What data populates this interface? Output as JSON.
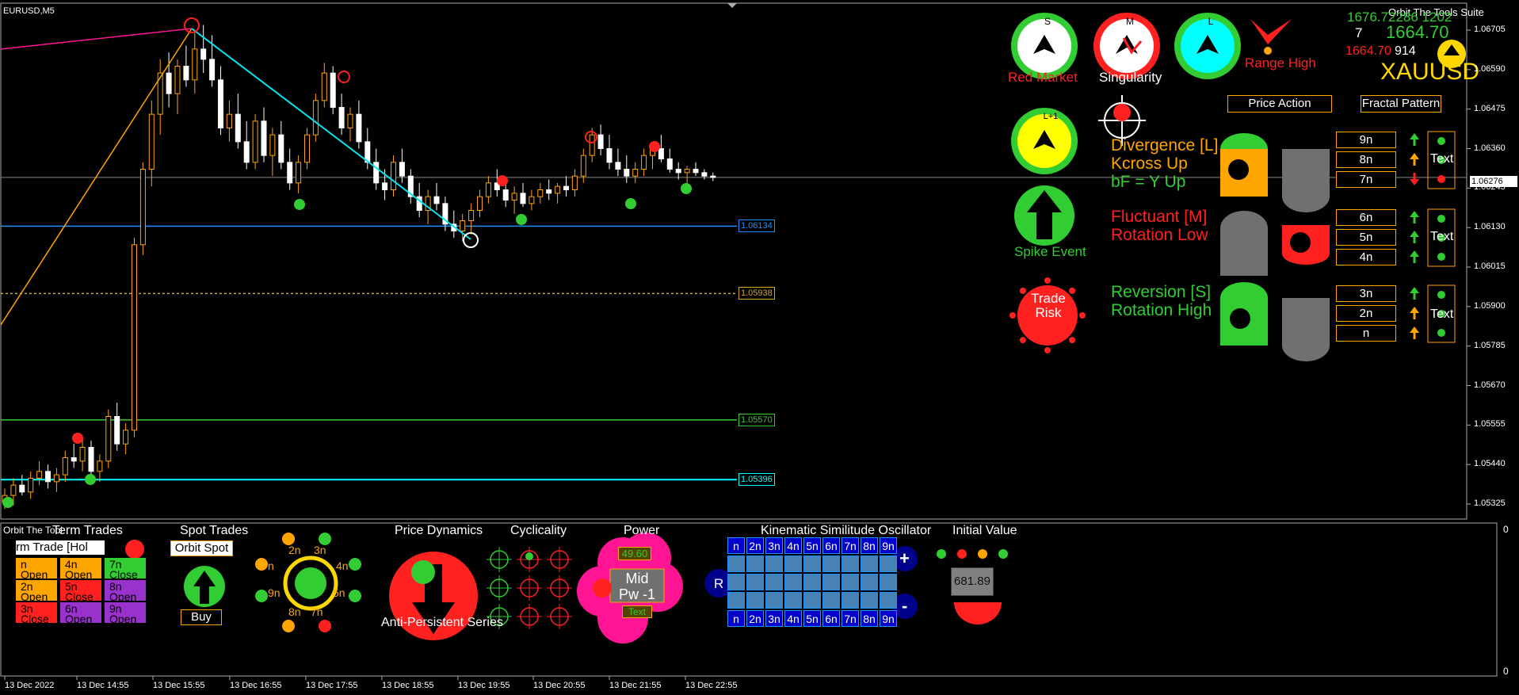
{
  "chart": {
    "symbol": "EURUSD,M5",
    "price_axis": [
      "1.06705",
      "1.06590",
      "1.06475",
      "1.06360",
      "1.06245",
      "1.06130",
      "1.06015",
      "1.05900",
      "1.05785",
      "1.05670",
      "1.05555",
      "1.05440",
      "1.05325"
    ],
    "current_price": "1.06276",
    "time_axis": [
      "13 Dec 2022",
      "13 Dec 14:55",
      "13 Dec 15:55",
      "13 Dec 16:55",
      "13 Dec 17:55",
      "13 Dec 18:55",
      "13 Dec 19:55",
      "13 Dec 20:55",
      "13 Dec 21:55",
      "13 Dec 22:55"
    ],
    "levels": [
      {
        "label": "1.06134",
        "color": "#1e90ff"
      },
      {
        "label": "1.05938",
        "color": "#daa520"
      },
      {
        "label": "1.05570",
        "color": "#32cd32"
      },
      {
        "label": "1.05396",
        "color": "#00ffff"
      }
    ],
    "candles": [
      {
        "o": 1.0533,
        "h": 1.0537,
        "l": 1.0531,
        "c": 1.0535
      },
      {
        "o": 1.0535,
        "h": 1.054,
        "l": 1.0532,
        "c": 1.0538
      },
      {
        "o": 1.0538,
        "h": 1.0541,
        "l": 1.0535,
        "c": 1.0536
      },
      {
        "o": 1.0536,
        "h": 1.0542,
        "l": 1.0534,
        "c": 1.054
      },
      {
        "o": 1.054,
        "h": 1.0545,
        "l": 1.0538,
        "c": 1.0542
      },
      {
        "o": 1.0542,
        "h": 1.0544,
        "l": 1.0537,
        "c": 1.0539
      },
      {
        "o": 1.0539,
        "h": 1.0543,
        "l": 1.0536,
        "c": 1.0541
      },
      {
        "o": 1.0541,
        "h": 1.0548,
        "l": 1.0539,
        "c": 1.0546
      },
      {
        "o": 1.0546,
        "h": 1.055,
        "l": 1.0543,
        "c": 1.0545
      },
      {
        "o": 1.0545,
        "h": 1.0552,
        "l": 1.0542,
        "c": 1.0549
      },
      {
        "o": 1.0549,
        "h": 1.0551,
        "l": 1.054,
        "c": 1.0542
      },
      {
        "o": 1.0542,
        "h": 1.0547,
        "l": 1.0539,
        "c": 1.0545
      },
      {
        "o": 1.0545,
        "h": 1.056,
        "l": 1.0543,
        "c": 1.0558
      },
      {
        "o": 1.0558,
        "h": 1.0562,
        "l": 1.0548,
        "c": 1.055
      },
      {
        "o": 1.055,
        "h": 1.0556,
        "l": 1.0547,
        "c": 1.0554
      },
      {
        "o": 1.0554,
        "h": 1.061,
        "l": 1.0552,
        "c": 1.0608
      },
      {
        "o": 1.0608,
        "h": 1.0632,
        "l": 1.0605,
        "c": 1.063
      },
      {
        "o": 1.063,
        "h": 1.065,
        "l": 1.0625,
        "c": 1.0646
      },
      {
        "o": 1.0646,
        "h": 1.0662,
        "l": 1.064,
        "c": 1.0658
      },
      {
        "o": 1.0658,
        "h": 1.0664,
        "l": 1.0648,
        "c": 1.0652
      },
      {
        "o": 1.0652,
        "h": 1.0662,
        "l": 1.0646,
        "c": 1.066
      },
      {
        "o": 1.066,
        "h": 1.0666,
        "l": 1.0654,
        "c": 1.0656
      },
      {
        "o": 1.0656,
        "h": 1.067,
        "l": 1.0652,
        "c": 1.0665
      },
      {
        "o": 1.0665,
        "h": 1.0672,
        "l": 1.0658,
        "c": 1.0662
      },
      {
        "o": 1.0662,
        "h": 1.0669,
        "l": 1.0654,
        "c": 1.0656
      },
      {
        "o": 1.0656,
        "h": 1.066,
        "l": 1.064,
        "c": 1.0642
      },
      {
        "o": 1.0642,
        "h": 1.065,
        "l": 1.0638,
        "c": 1.0646
      },
      {
        "o": 1.0646,
        "h": 1.0652,
        "l": 1.0636,
        "c": 1.0638
      },
      {
        "o": 1.0638,
        "h": 1.0644,
        "l": 1.063,
        "c": 1.0632
      },
      {
        "o": 1.0632,
        "h": 1.0646,
        "l": 1.063,
        "c": 1.0644
      },
      {
        "o": 1.0644,
        "h": 1.0648,
        "l": 1.0632,
        "c": 1.0634
      },
      {
        "o": 1.0634,
        "h": 1.0642,
        "l": 1.0628,
        "c": 1.064
      },
      {
        "o": 1.064,
        "h": 1.0644,
        "l": 1.063,
        "c": 1.0632
      },
      {
        "o": 1.0632,
        "h": 1.0636,
        "l": 1.0624,
        "c": 1.0626
      },
      {
        "o": 1.0626,
        "h": 1.0634,
        "l": 1.0623,
        "c": 1.0632
      },
      {
        "o": 1.0632,
        "h": 1.0642,
        "l": 1.063,
        "c": 1.064
      },
      {
        "o": 1.064,
        "h": 1.0652,
        "l": 1.0638,
        "c": 1.065
      },
      {
        "o": 1.065,
        "h": 1.0661,
        "l": 1.0648,
        "c": 1.0658
      },
      {
        "o": 1.0658,
        "h": 1.066,
        "l": 1.0646,
        "c": 1.0648
      },
      {
        "o": 1.0648,
        "h": 1.0652,
        "l": 1.064,
        "c": 1.0642
      },
      {
        "o": 1.0642,
        "h": 1.0648,
        "l": 1.0638,
        "c": 1.0646
      },
      {
        "o": 1.0646,
        "h": 1.065,
        "l": 1.0636,
        "c": 1.0638
      },
      {
        "o": 1.0638,
        "h": 1.0642,
        "l": 1.063,
        "c": 1.0632
      },
      {
        "o": 1.0632,
        "h": 1.0636,
        "l": 1.0624,
        "c": 1.0626
      },
      {
        "o": 1.0626,
        "h": 1.063,
        "l": 1.0621,
        "c": 1.0624
      },
      {
        "o": 1.0624,
        "h": 1.0634,
        "l": 1.0622,
        "c": 1.0632
      },
      {
        "o": 1.0632,
        "h": 1.0636,
        "l": 1.0626,
        "c": 1.0628
      },
      {
        "o": 1.0628,
        "h": 1.063,
        "l": 1.062,
        "c": 1.0622
      },
      {
        "o": 1.0622,
        "h": 1.0626,
        "l": 1.0616,
        "c": 1.0618
      },
      {
        "o": 1.0618,
        "h": 1.0624,
        "l": 1.0614,
        "c": 1.0622
      },
      {
        "o": 1.0622,
        "h": 1.0626,
        "l": 1.0618,
        "c": 1.062
      },
      {
        "o": 1.062,
        "h": 1.0622,
        "l": 1.0612,
        "c": 1.0614
      },
      {
        "o": 1.0614,
        "h": 1.0618,
        "l": 1.061,
        "c": 1.0612
      },
      {
        "o": 1.0612,
        "h": 1.0617,
        "l": 1.0609,
        "c": 1.0615
      },
      {
        "o": 1.0615,
        "h": 1.062,
        "l": 1.0611,
        "c": 1.0618
      },
      {
        "o": 1.0618,
        "h": 1.0624,
        "l": 1.0616,
        "c": 1.0622
      },
      {
        "o": 1.0622,
        "h": 1.0628,
        "l": 1.062,
        "c": 1.0626
      },
      {
        "o": 1.0626,
        "h": 1.063,
        "l": 1.0622,
        "c": 1.0624
      },
      {
        "o": 1.0624,
        "h": 1.0627,
        "l": 1.0619,
        "c": 1.0621
      },
      {
        "o": 1.0621,
        "h": 1.0625,
        "l": 1.0617,
        "c": 1.0623
      },
      {
        "o": 1.0623,
        "h": 1.0626,
        "l": 1.0619,
        "c": 1.062
      },
      {
        "o": 1.062,
        "h": 1.0624,
        "l": 1.0618,
        "c": 1.0622
      },
      {
        "o": 1.0622,
        "h": 1.0626,
        "l": 1.062,
        "c": 1.0624
      },
      {
        "o": 1.0624,
        "h": 1.0627,
        "l": 1.0621,
        "c": 1.0623
      },
      {
        "o": 1.0623,
        "h": 1.0626,
        "l": 1.062,
        "c": 1.0625
      },
      {
        "o": 1.0625,
        "h": 1.0628,
        "l": 1.0622,
        "c": 1.0624
      },
      {
        "o": 1.0624,
        "h": 1.063,
        "l": 1.0622,
        "c": 1.0628
      },
      {
        "o": 1.0628,
        "h": 1.0636,
        "l": 1.0626,
        "c": 1.0634
      },
      {
        "o": 1.0634,
        "h": 1.0642,
        "l": 1.0632,
        "c": 1.064
      },
      {
        "o": 1.064,
        "h": 1.0643,
        "l": 1.0634,
        "c": 1.0636
      },
      {
        "o": 1.0636,
        "h": 1.064,
        "l": 1.063,
        "c": 1.0632
      },
      {
        "o": 1.0632,
        "h": 1.0636,
        "l": 1.0628,
        "c": 1.063
      },
      {
        "o": 1.063,
        "h": 1.0634,
        "l": 1.0626,
        "c": 1.0628
      },
      {
        "o": 1.0628,
        "h": 1.0632,
        "l": 1.0626,
        "c": 1.063
      },
      {
        "o": 1.063,
        "h": 1.0636,
        "l": 1.0628,
        "c": 1.0634
      },
      {
        "o": 1.0634,
        "h": 1.0638,
        "l": 1.063,
        "c": 1.0636
      },
      {
        "o": 1.0636,
        "h": 1.064,
        "l": 1.0632,
        "c": 1.0633
      },
      {
        "o": 1.0633,
        "h": 1.0636,
        "l": 1.0629,
        "c": 1.063
      },
      {
        "o": 1.063,
        "h": 1.0632,
        "l": 1.0627,
        "c": 1.0629
      },
      {
        "o": 1.0629,
        "h": 1.0631,
        "l": 1.0626,
        "c": 1.063
      },
      {
        "o": 1.063,
        "h": 1.0632,
        "l": 1.0628,
        "c": 1.0629
      },
      {
        "o": 1.0629,
        "h": 1.063,
        "l": 1.0627,
        "c": 1.0628
      },
      {
        "o": 1.0628,
        "h": 1.0629,
        "l": 1.06265,
        "c": 1.06276
      }
    ]
  },
  "hud": {
    "circles": [
      {
        "letter": "S",
        "label": "Red Market"
      },
      {
        "letter": "M",
        "label": "Singularity"
      },
      {
        "letter": "L",
        "label": ""
      }
    ],
    "range_high": "Range High",
    "l1_letter": "L+1",
    "spike_event": "Spike Event",
    "trade_risk_1": "Trade",
    "trade_risk_2": "Risk",
    "tab_price_action": "Price Action",
    "tab_fractal": "Fractal Pattern",
    "info_lines": [
      {
        "text": "Orbit The Tools Suite",
        "color": "#ffffff"
      },
      {
        "text": "1676.72286 1202",
        "color": "#32cd32"
      }
    ],
    "big_value": "1664.70",
    "num_seven": "7",
    "red_value": "1664.70",
    "white_value": "914",
    "ticker": "XAUUSD",
    "signals": [
      {
        "line1": "Divergence [L]",
        "line2": "Kcross Up",
        "line3": "bF = Y Up",
        "c1": "#ffa500",
        "c2": "#ffa500",
        "c3": "#32cd32"
      },
      {
        "line1": "Fluctuant [M]",
        "line2": "Rotation Low",
        "line3": "",
        "c1": "#ff2020",
        "c2": "#ff2020",
        "c3": "#ff2020"
      },
      {
        "line1": "Reversion [S]",
        "line2": "Rotation High",
        "line3": "",
        "c1": "#32cd32",
        "c2": "#32cd32",
        "c3": "#32cd32"
      }
    ],
    "n_boxes": [
      "9n",
      "8n",
      "7n",
      "6n",
      "5n",
      "4n",
      "3n",
      "2n",
      "n"
    ],
    "text_label": "Text"
  },
  "bottom": {
    "corner_label": "Orbit The Tool",
    "scale_top": "0",
    "scale_bottom": "0",
    "term_trades": {
      "title": "Term Trades",
      "select": "rm Trade [Hol",
      "cells": [
        {
          "n": "n",
          "s": "Open",
          "bg": "#ffa500"
        },
        {
          "n": "4n",
          "s": "Open",
          "bg": "#ffa500"
        },
        {
          "n": "7n",
          "s": "Close",
          "bg": "#32cd32"
        },
        {
          "n": "2n",
          "s": "Open",
          "bg": "#ffa500"
        },
        {
          "n": "5n",
          "s": "Close",
          "bg": "#ff2020"
        },
        {
          "n": "8n",
          "s": "Open",
          "bg": "#9932cc"
        },
        {
          "n": "3n",
          "s": "Close",
          "bg": "#ff2020"
        },
        {
          "n": "6n",
          "s": "Open",
          "bg": "#9932cc"
        },
        {
          "n": "9n",
          "s": "Open",
          "bg": "#9932cc"
        }
      ]
    },
    "spot_trades": {
      "title": "Spot Trades",
      "select": "Orbit Spot",
      "button": "Buy"
    },
    "orbit_labels": [
      "2n",
      "3n",
      "4n",
      "5n",
      "7n",
      "8n",
      "9n",
      "n"
    ],
    "price_dynamics": {
      "title": "Price Dynamics",
      "caption": "Anti-Persistent Series"
    },
    "cyclicality": {
      "title": "Cyclicality"
    },
    "power": {
      "title": "Power",
      "value": "49.60",
      "mid": "Mid",
      "pw": "Pw -1",
      "text": "Text"
    },
    "kso": {
      "title": "Kinematic Similitude Oscillator",
      "row_labels": [
        "n",
        "2n",
        "3n",
        "4n",
        "5n",
        "6n",
        "7n",
        "8n",
        "9n"
      ],
      "r_label": "R",
      "plus": "+",
      "minus": "-"
    },
    "initial_value": {
      "title": "Initial Value",
      "value": "681.89"
    }
  }
}
